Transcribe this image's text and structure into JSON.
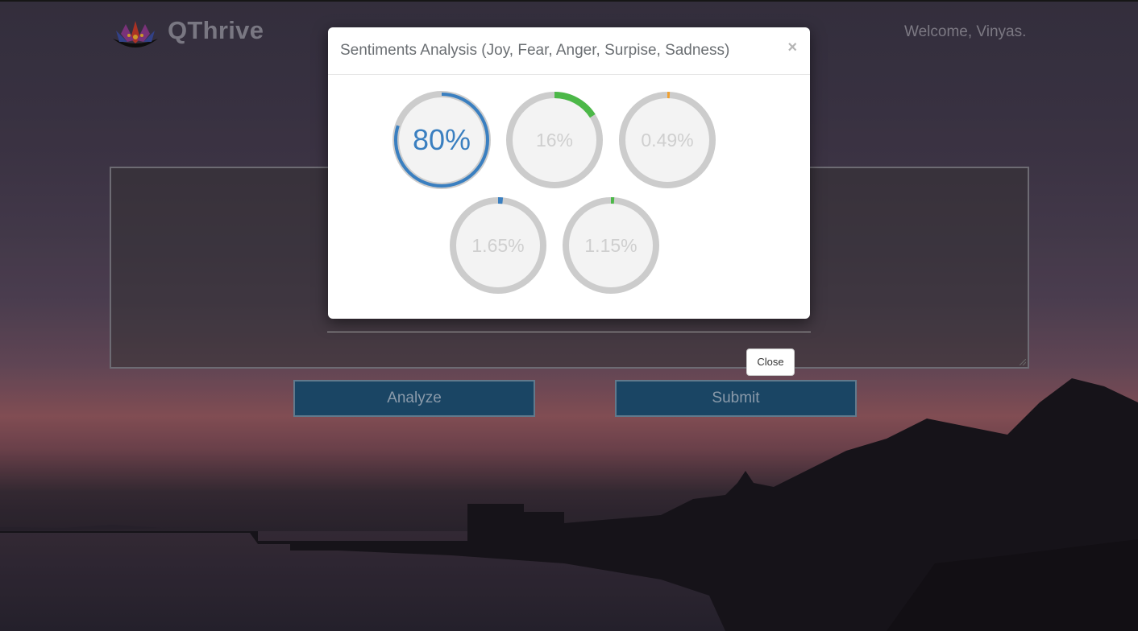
{
  "header": {
    "brand": "QThrive",
    "welcome": "Welcome, Vinyas."
  },
  "buttons": {
    "analyze_label": "Analyze",
    "submit_label": "Submit",
    "close_label": "Close"
  },
  "modal": {
    "title": "Sentiments Analysis (Joy, Fear, Anger, Surpise, Sadness)",
    "close_glyph": "×",
    "gauges": [
      {
        "label": "80%",
        "fraction": 0.8,
        "color": "#3a7fc0"
      },
      {
        "label": "16%",
        "fraction": 0.16,
        "color": "#4cb848"
      },
      {
        "label": "0.49%",
        "fraction": 0.0049,
        "color": "#f0a030"
      },
      {
        "label": "1.65%",
        "fraction": 0.0165,
        "color": "#3a7fc0"
      },
      {
        "label": "1.15%",
        "fraction": 0.0115,
        "color": "#4cb848"
      }
    ]
  },
  "colors": {
    "button_bg": "#1e4f72",
    "track": "#cccccc"
  }
}
